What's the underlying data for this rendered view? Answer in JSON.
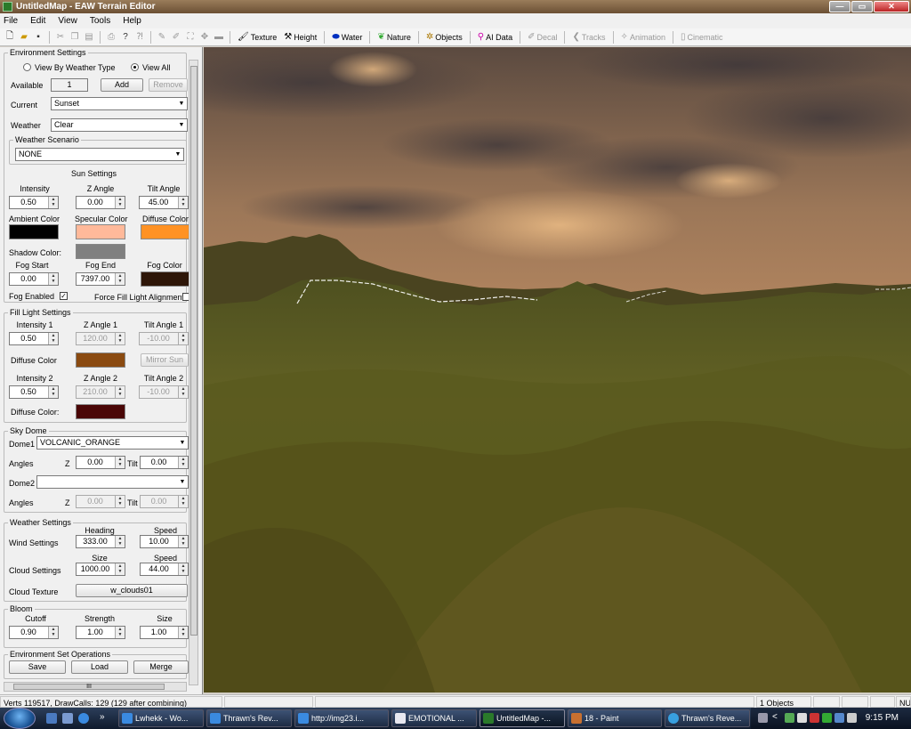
{
  "window": {
    "title": "UntitledMap - EAW Terrain Editor"
  },
  "menu": [
    "File",
    "Edit",
    "View",
    "Tools",
    "Help"
  ],
  "toolbar": {
    "tools": [
      {
        "label": "Texture",
        "icon": "brush-icon",
        "enabled": true
      },
      {
        "label": "Height",
        "icon": "hammer-icon",
        "enabled": true
      },
      {
        "label": "Water",
        "icon": "water-icon",
        "enabled": true
      },
      {
        "label": "Nature",
        "icon": "plant-icon",
        "enabled": true
      },
      {
        "label": "Objects",
        "icon": "objects-icon",
        "enabled": true
      },
      {
        "label": "AI Data",
        "icon": "ai-data-icon",
        "enabled": true
      },
      {
        "label": "Decal",
        "icon": "decal-icon",
        "enabled": false
      },
      {
        "label": "Tracks",
        "icon": "tracks-icon",
        "enabled": false
      },
      {
        "label": "Animation",
        "icon": "animation-icon",
        "enabled": false
      },
      {
        "label": "Cinematic",
        "icon": "cinematic-icon",
        "enabled": false
      }
    ]
  },
  "env": {
    "title": "Environment Settings",
    "view_by_weather": "View By Weather Type",
    "view_all": "View All",
    "available_label": "Available",
    "available_value": "1",
    "add": "Add",
    "remove": "Remove",
    "current_label": "Current",
    "current_value": "Sunset",
    "weather_label": "Weather",
    "weather_value": "Clear",
    "scenario_title": "Weather Scenario",
    "scenario_value": "NONE",
    "sun_title": "Sun Settings",
    "intensity_label": "Intensity",
    "zangle_label": "Z Angle",
    "tilt_label": "Tilt Angle",
    "intensity": "0.50",
    "zangle": "0.00",
    "tilt": "45.00",
    "ambient_label": "Ambient Color",
    "specular_label": "Specular Color",
    "diffuse_label": "Diffuse Color",
    "shadow_label": "Shadow Color:",
    "fog_start_label": "Fog Start",
    "fog_end_label": "Fog End",
    "fog_color_label": "Fog Color",
    "fog_start": "0.00",
    "fog_end": "7397.00",
    "fog_enabled": "Fog Enabled",
    "force_fill": "Force Fill Light Alignment"
  },
  "colors": {
    "ambient": "#000000",
    "specular": "#ffb99a",
    "diffuse": "#ff9224",
    "shadow": "#808080",
    "fog": "#2e1608",
    "fill_diffuse1": "#8a4a10",
    "fill_diffuse2": "#4a0606"
  },
  "fill": {
    "title": "Fill Light Settings",
    "intensity1_label": "Intensity 1",
    "zangle1_label": "Z Angle 1",
    "tilt1_label": "Tilt Angle 1",
    "intensity1": "0.50",
    "zangle1": "120.00",
    "tilt1": "-10.00",
    "diffuse_label": "Diffuse Color",
    "mirror": "Mirror Sun",
    "intensity2_label": "Intensity 2",
    "zangle2_label": "Z Angle 2",
    "tilt2_label": "Tilt Angle 2",
    "intensity2": "0.50",
    "zangle2": "210.00",
    "tilt2": "-10.00",
    "diffuse2_label": "Diffuse Color:"
  },
  "sky": {
    "title": "Sky Dome",
    "dome1_label": "Dome1",
    "dome1_value": "VOLCANIC_ORANGE",
    "angles_label": "Angles",
    "z_label": "Z",
    "tilt_label": "Tilt",
    "z1": "0.00",
    "tilt1": "0.00",
    "dome2_label": "Dome2",
    "dome2_value": "",
    "z2": "0.00",
    "tilt2": "0.00"
  },
  "weather": {
    "title": "Weather Settings",
    "heading_label": "Heading",
    "speed_label": "Speed",
    "wind_label": "Wind Settings",
    "wind_heading": "333.00",
    "wind_speed": "10.00",
    "size_label": "Size",
    "cloud_speed_label": "Speed",
    "cloud_label": "Cloud Settings",
    "cloud_size": "1000.00",
    "cloud_speed": "44.00",
    "texture_label": "Cloud Texture",
    "texture_value": "w_clouds01"
  },
  "bloom": {
    "title": "Bloom",
    "cutoff_label": "Cutoff",
    "strength_label": "Strength",
    "size_label": "Size",
    "cutoff": "0.90",
    "strength": "1.00",
    "size": "1.00"
  },
  "ops": {
    "title": "Environment Set Operations",
    "save": "Save",
    "load": "Load",
    "merge": "Merge"
  },
  "scroll_grip": "III",
  "status": {
    "verts": "Verts 119517, DrawCalls: 129 (129 after combining)",
    "objects": "1 Objects",
    "num": "NU"
  },
  "taskbar": {
    "chevron": "»",
    "tasks": [
      "Lwhekk - Wo...",
      "Thrawn's Rev...",
      "http://img23.i...",
      "EMOTIONAL ...",
      "UntitledMap -...",
      "18 - Paint",
      "Thrawn's Reve..."
    ],
    "active_index": 4,
    "tray_chevron": "<",
    "clock": "9:15 PM"
  }
}
